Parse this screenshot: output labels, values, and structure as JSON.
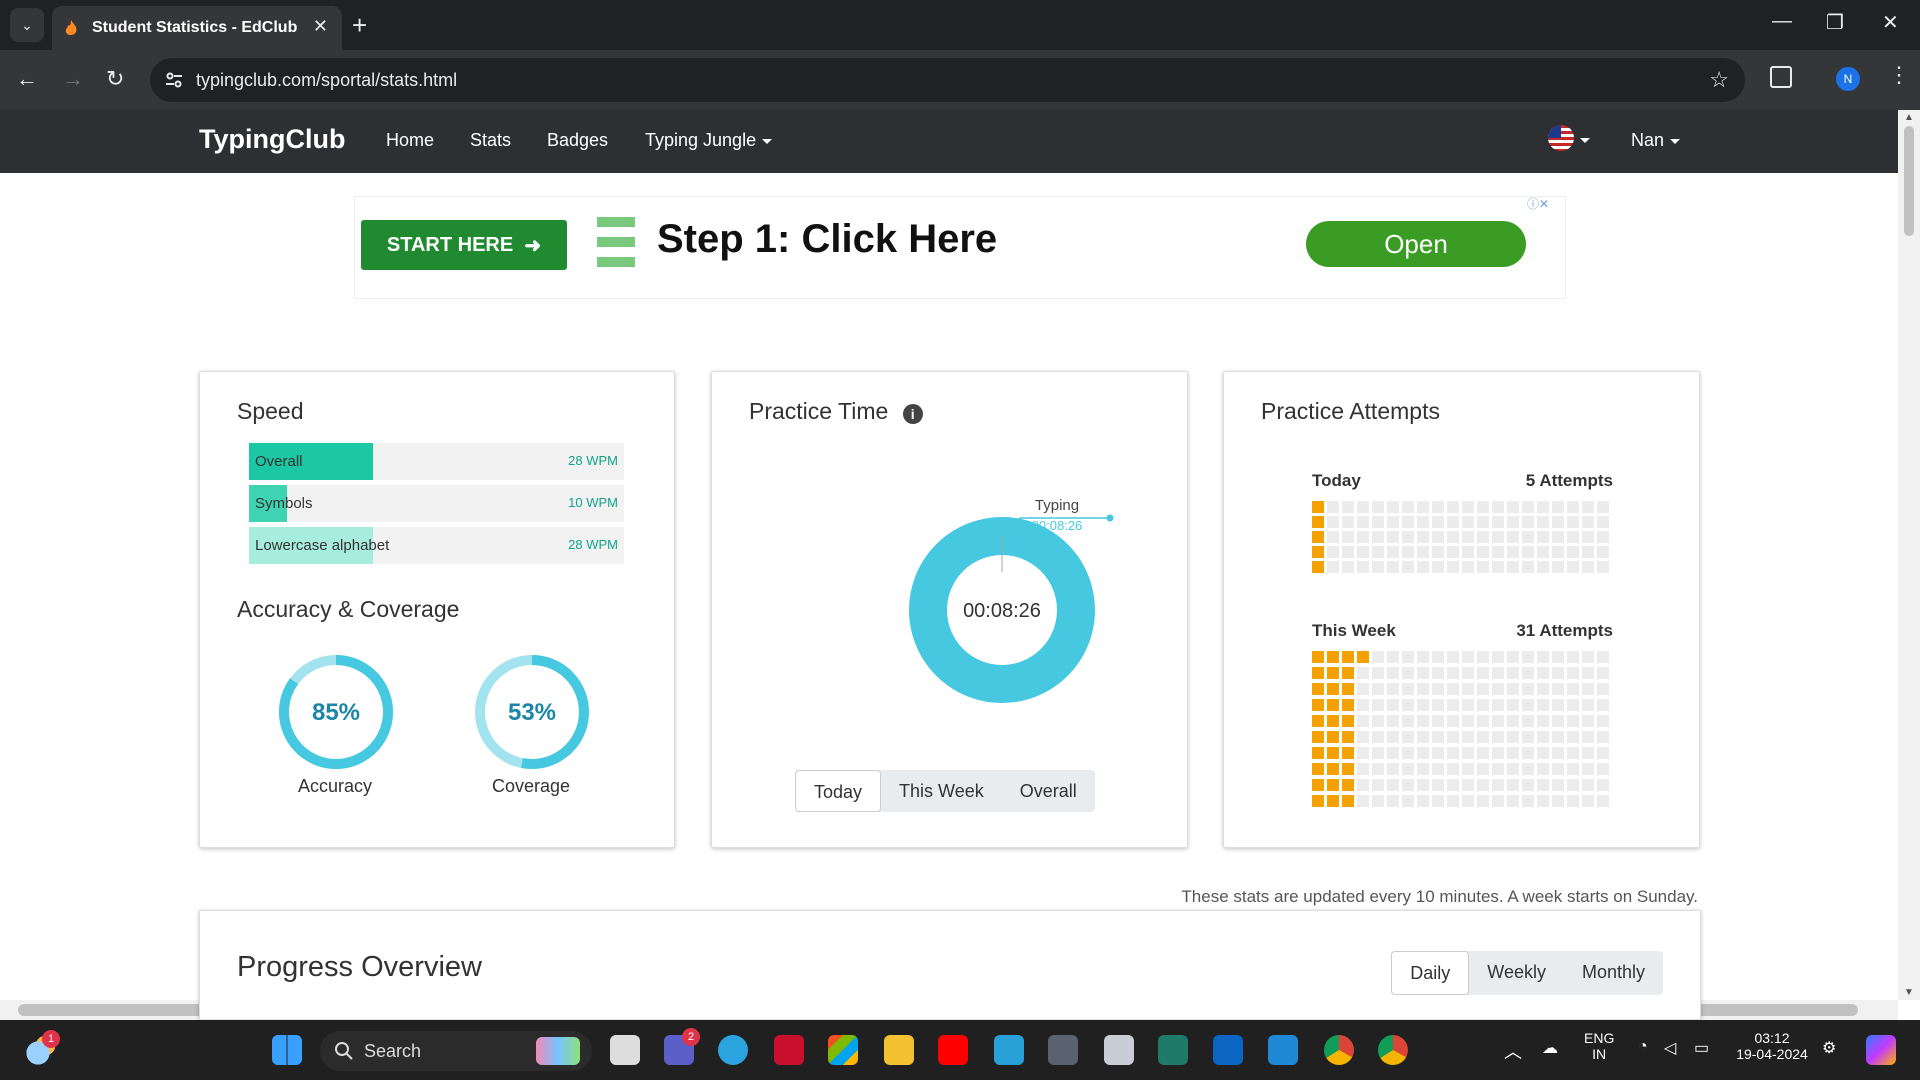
{
  "browser": {
    "tab_title": "Student Statistics - EdClub",
    "url": "typingclub.com/sportal/stats.html",
    "profile_initial": "N"
  },
  "site": {
    "logo": "TypingClub",
    "nav": [
      "Home",
      "Stats",
      "Badges",
      "Typing Jungle"
    ],
    "user": "Nan"
  },
  "ad": {
    "cta": "START HERE",
    "title": "Step 1: Click Here",
    "open": "Open"
  },
  "speed": {
    "title": "Speed",
    "rows": [
      {
        "label": "Overall",
        "wpm": "28 WPM",
        "pct": 0.33,
        "color": "#1cc7a3"
      },
      {
        "label": "Symbols",
        "wpm": "10 WPM",
        "pct": 0.1,
        "color": "#3fd3b1"
      },
      {
        "label": "Lowercase alphabet",
        "wpm": "28 WPM",
        "pct": 0.33,
        "color": "#a6eddd"
      }
    ]
  },
  "accuracy": {
    "title": "Accuracy & Coverage",
    "accuracy_value": "85%",
    "accuracy_label": "Accuracy",
    "accuracy_pct": 0.85,
    "coverage_value": "53%",
    "coverage_label": "Coverage",
    "coverage_pct": 0.53
  },
  "practice_time": {
    "title": "Practice Time",
    "center": "00:08:26",
    "callout_label": "Typing",
    "callout_value": "00:08:26",
    "tabs": [
      "Today",
      "This Week",
      "Overall"
    ],
    "active_tab": "Today"
  },
  "attempts": {
    "title": "Practice Attempts",
    "today_label": "Today",
    "today_count": "5 Attempts",
    "today_value": 5,
    "week_label": "This Week",
    "week_count": "31 Attempts",
    "week_value": 31
  },
  "note": "These stats are updated every 10 minutes. A week starts on Sunday.",
  "progress": {
    "title": "Progress Overview",
    "tabs": [
      "Daily",
      "Weekly",
      "Monthly"
    ],
    "active_tab": "Daily"
  },
  "taskbar": {
    "search": "Search",
    "lang": "ENG",
    "region": "IN",
    "time": "03:12",
    "date": "19-04-2024",
    "weather_badge": "1",
    "teams_badge": "2"
  },
  "colors": {
    "accent": "#45c8e0",
    "attempt": "#f5a100",
    "speed": "#1cc7a3"
  }
}
